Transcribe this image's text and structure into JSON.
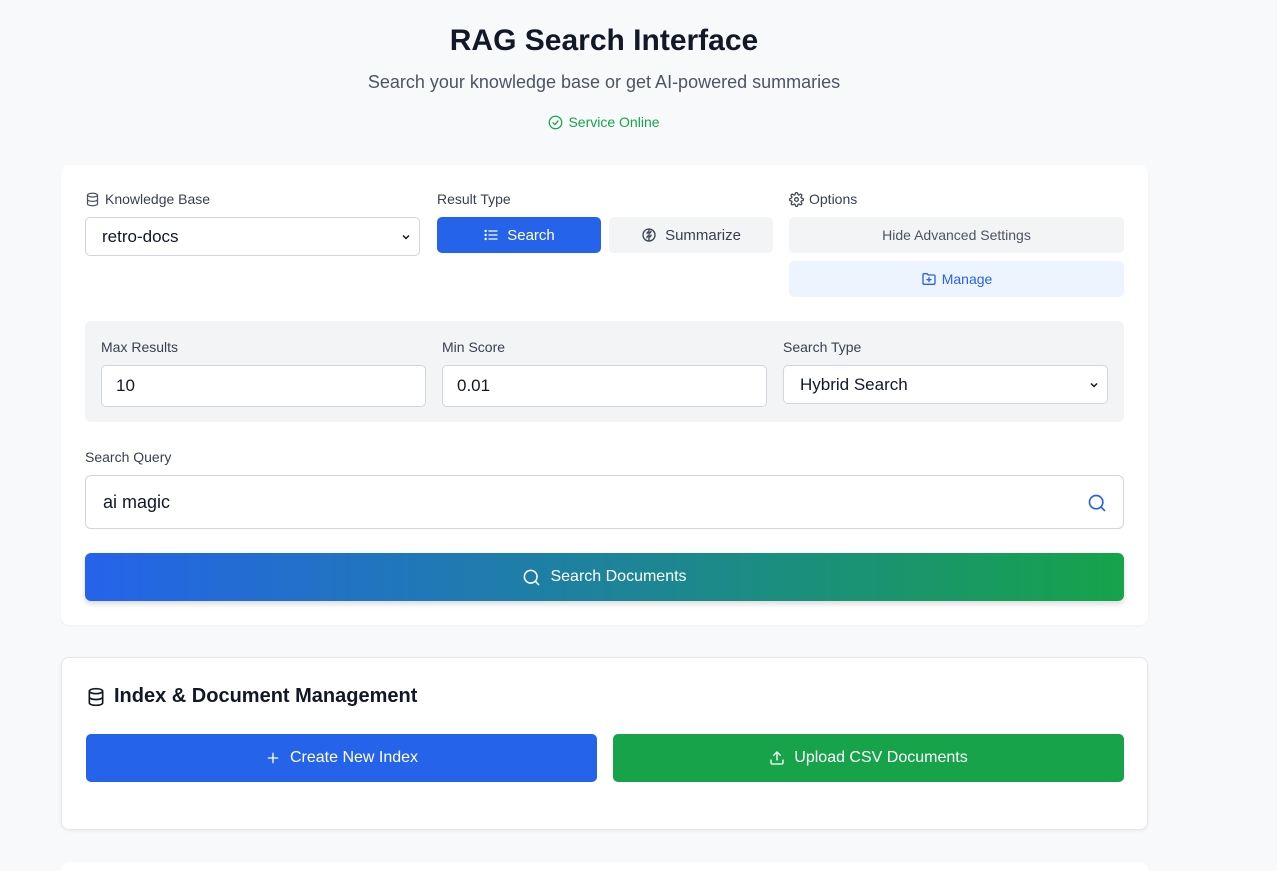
{
  "header": {
    "title": "RAG Search Interface",
    "subtitle": "Search your knowledge base or get AI-powered summaries",
    "status": "Service Online",
    "status_color": "#16a34a"
  },
  "search_panel": {
    "knowledge_base_label": "Knowledge Base",
    "knowledge_base_value": "retro-docs",
    "result_type_label": "Result Type",
    "result_type_options": [
      "Search",
      "Summarize"
    ],
    "result_type_selected": "Search",
    "options_label": "Options",
    "hide_advanced_label": "Hide Advanced Settings",
    "manage_label": "Manage",
    "advanced": {
      "max_results_label": "Max Results",
      "max_results_value": "10",
      "min_score_label": "Min Score",
      "min_score_value": "0.01",
      "search_type_label": "Search Type",
      "search_type_value": "Hybrid Search"
    },
    "query_label": "Search Query",
    "query_value": "ai magic",
    "submit_label": "Search Documents"
  },
  "management": {
    "title": "Index & Document Management",
    "create_label": "Create New Index",
    "upload_label": "Upload CSV Documents"
  },
  "colors": {
    "primary": "#2563eb",
    "success": "#16a34a",
    "background": "#f8f9fb"
  }
}
